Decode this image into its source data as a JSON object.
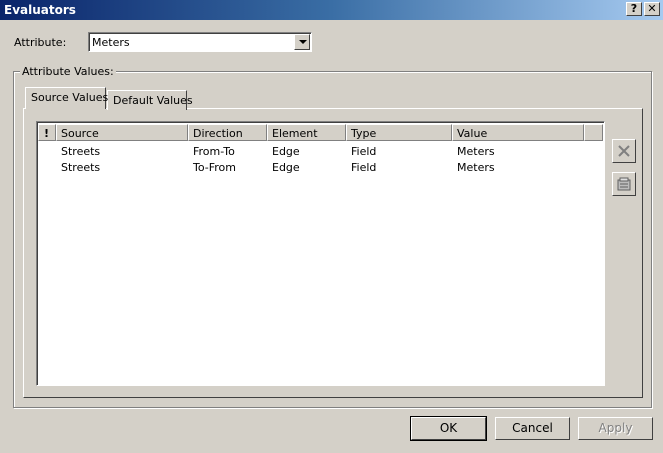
{
  "window": {
    "title": "Evaluators",
    "help_label": "?",
    "close_label": "✕"
  },
  "attribute": {
    "label": "Attribute:",
    "value": "Meters"
  },
  "group": {
    "label": "Attribute Values:"
  },
  "tabs": [
    {
      "label": "Source Values",
      "active": true
    },
    {
      "label": "Default Values",
      "active": false
    }
  ],
  "table": {
    "columns": [
      "!",
      "Source",
      "Direction",
      "Element",
      "Type",
      "Value"
    ],
    "rows": [
      {
        "flag": "",
        "source": "Streets",
        "direction": "From-To",
        "element": "Edge",
        "type": "Field",
        "value": "Meters"
      },
      {
        "flag": "",
        "source": "Streets",
        "direction": "To-From",
        "element": "Edge",
        "type": "Field",
        "value": "Meters"
      }
    ]
  },
  "side_buttons": {
    "delete_icon": "delete-x-icon",
    "properties_icon": "properties-icon"
  },
  "buttons": {
    "ok": "OK",
    "cancel": "Cancel",
    "apply": "Apply"
  }
}
